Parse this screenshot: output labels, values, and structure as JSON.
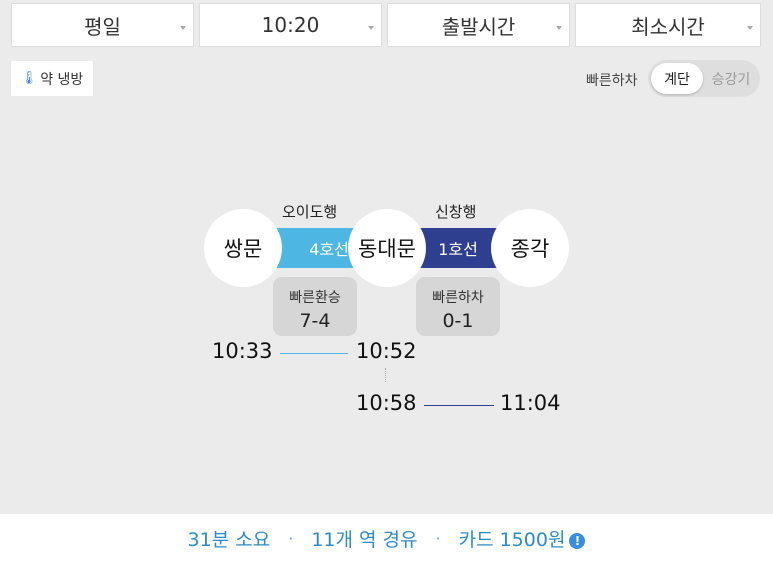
{
  "filters": {
    "day": "평일",
    "time": "10:20",
    "mode": "출발시간",
    "sort": "최소시간"
  },
  "cooling": {
    "label": "약 냉방",
    "icon": "thermometer-icon"
  },
  "exit_option": {
    "label": "빠른하차",
    "selected": "계단",
    "other": "승강기"
  },
  "route": {
    "stations": [
      "쌍문",
      "동대문",
      "종각"
    ],
    "legs": [
      {
        "line": "4호선",
        "direction": "오이도행",
        "color": "#4db6e2",
        "transfer_title": "빠른환승",
        "transfer_value": "7-4",
        "depart": "10:33",
        "arrive": "10:52"
      },
      {
        "line": "1호선",
        "direction": "신창행",
        "color": "#2f3f8f",
        "transfer_title": "빠른하차",
        "transfer_value": "0-1",
        "depart": "10:58",
        "arrive": "11:04"
      }
    ]
  },
  "summary": {
    "duration": "31분 소요",
    "stations": "11개 역 경유",
    "fare": "카드 1500원",
    "info_icon": "info-icon"
  }
}
